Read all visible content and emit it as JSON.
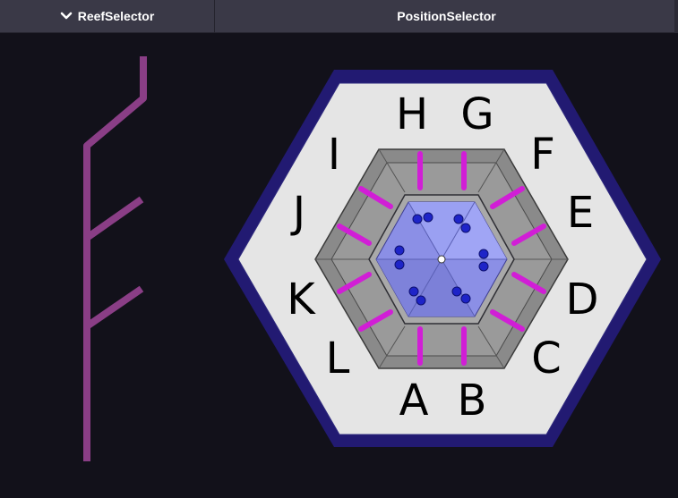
{
  "tabs": {
    "reef_selector": "ReefSelector",
    "position_selector": "PositionSelector"
  },
  "positions": [
    "A",
    "B",
    "C",
    "D",
    "E",
    "F",
    "G",
    "H",
    "I",
    "J",
    "K",
    "L"
  ],
  "colors": {
    "background": "#12111a",
    "tab_bg": "#3a3947",
    "branch": "#8a3e86",
    "hex_border": "#221a72",
    "hex_fill": "#e5e5e5",
    "reef_blue": "#8b8fe6",
    "pipe": "#d11ed6",
    "metal": "#8a8a8a"
  },
  "icons": {
    "tab_chevron": "chevron-down-icon"
  }
}
